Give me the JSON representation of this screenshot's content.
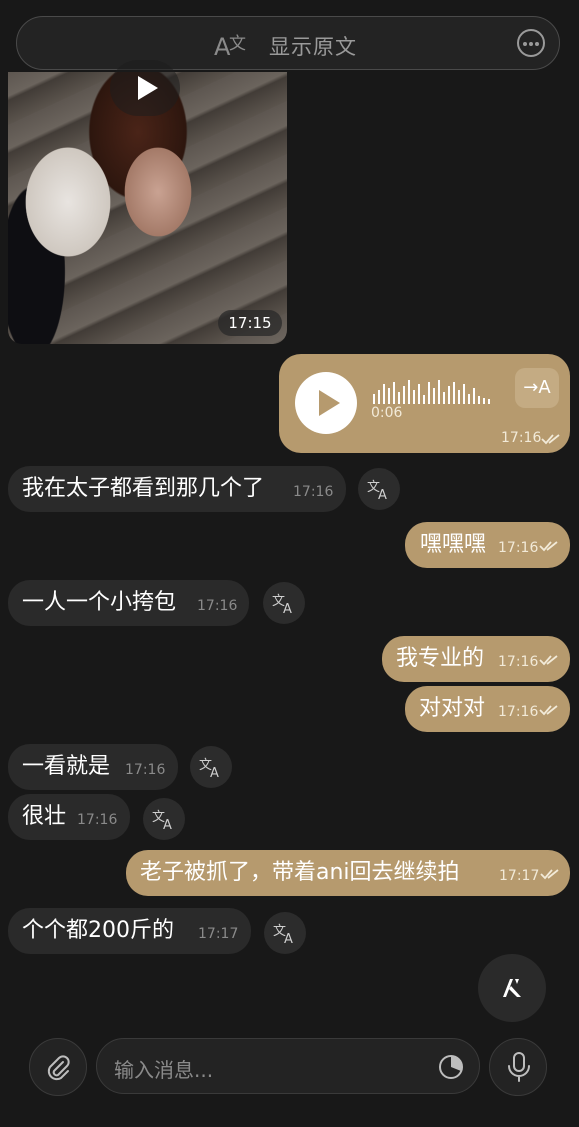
{
  "header": {
    "translate_label": "显示原文"
  },
  "video": {
    "time": "17:15"
  },
  "voice": {
    "duration": "0:06",
    "time": "17:16",
    "translate_label": "→A"
  },
  "messages": [
    {
      "text": "我在太子都看到那几个了",
      "time": "17:16",
      "dir": "in"
    },
    {
      "text": "嘿嘿嘿",
      "time": "17:16",
      "dir": "out"
    },
    {
      "text": "一人一个小挎包",
      "time": "17:16",
      "dir": "in"
    },
    {
      "text": "我专业的",
      "time": "17:16",
      "dir": "out"
    },
    {
      "text": "对对对",
      "time": "17:16",
      "dir": "out"
    },
    {
      "text": "一看就是",
      "time": "17:16",
      "dir": "in"
    },
    {
      "text": "很壮",
      "time": "17:16",
      "dir": "in"
    },
    {
      "text": "老子被抓了，带着ani回去继续拍",
      "time": "17:17",
      "dir": "out"
    },
    {
      "text": "个个都200斤的",
      "time": "17:17",
      "dir": "in"
    }
  ],
  "composer": {
    "placeholder": "输入消息..."
  },
  "colors": {
    "background": "#181818",
    "incoming": "#2a2a2a",
    "outgoing": "#b69a6e"
  }
}
